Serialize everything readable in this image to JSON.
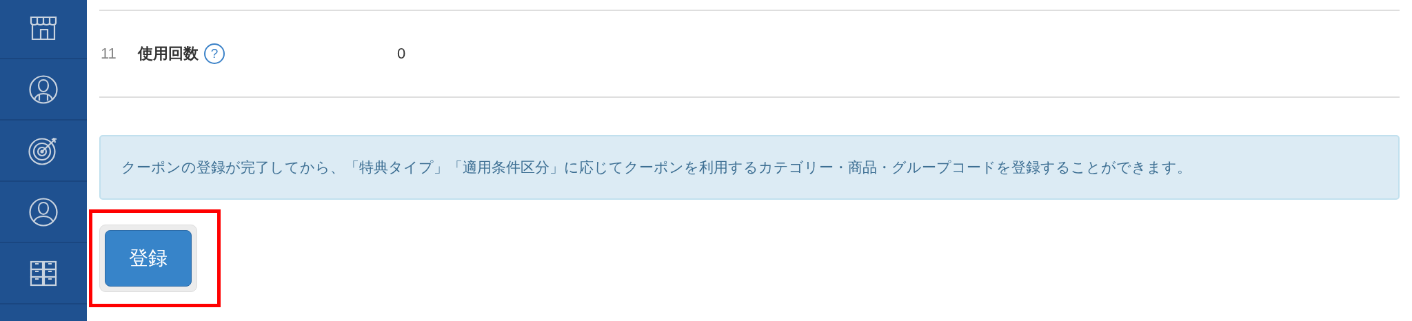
{
  "sidebar": {
    "items": [
      {
        "kind": "store"
      },
      {
        "kind": "staff"
      },
      {
        "kind": "target"
      },
      {
        "kind": "person"
      },
      {
        "kind": "drawers"
      }
    ]
  },
  "fields": [
    {
      "number": "11",
      "label": "使用回数",
      "help": "?",
      "value": "0"
    }
  ],
  "notice": "クーポンの登録が完了してから、「特典タイプ」「適用条件区分」に応じてクーポンを利用するカテゴリー・商品・グループコードを登録することができます。",
  "submit": {
    "label": "登録",
    "highlighted": true
  }
}
